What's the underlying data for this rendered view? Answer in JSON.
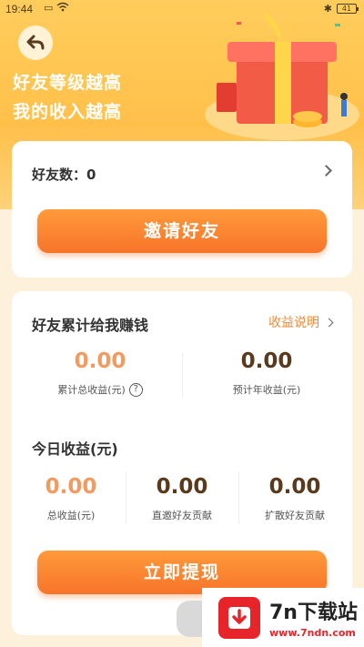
{
  "status": {
    "time": "19:44",
    "battery": "41"
  },
  "header": {
    "line1": "好友等级越高",
    "line2": "我的收入越高"
  },
  "friends": {
    "label": "好友数：",
    "count": "0",
    "invite_button": "邀请好友"
  },
  "earnings": {
    "title": "好友累计给我赚钱",
    "explain_link": "收益说明",
    "total_value": "0.00",
    "total_label": "累计总收益(元)",
    "yearly_value": "0.00",
    "yearly_label": "预计年收益(元)"
  },
  "today": {
    "title": "今日收益(元)",
    "items": [
      {
        "value": "0.00",
        "label": "总收益(元)"
      },
      {
        "value": "0.00",
        "label": "直邀好友贡献"
      },
      {
        "value": "0.00",
        "label": "扩散好友贡献"
      }
    ],
    "withdraw_button": "立即提现"
  },
  "watermark": {
    "title": "7n下载站",
    "url": "www.7ndn.com"
  },
  "colors": {
    "accent": "#f7742a",
    "hero": "#ffc04a",
    "orange_number": "#f39a61",
    "dark_number": "#5a3a1c"
  }
}
